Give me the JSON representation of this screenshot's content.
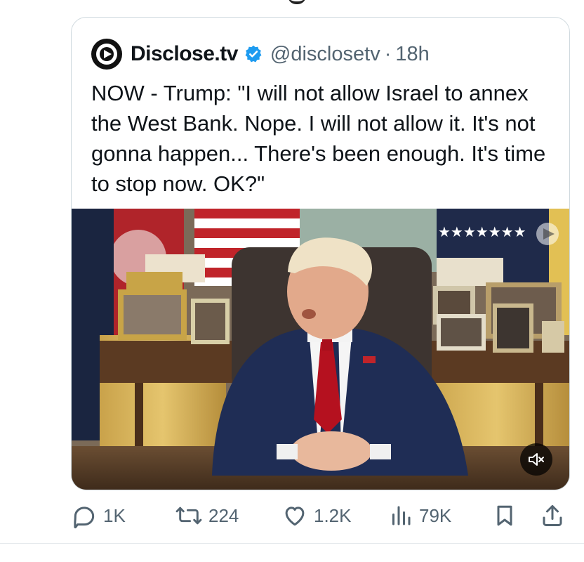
{
  "quote": {
    "display_name": "Disclose.tv",
    "handle": "@disclosetv",
    "separator": "·",
    "time": "18h",
    "text": "NOW - Trump: \"I will not allow Israel to annex the West Bank. Nope. I will not allow it. It's not gonna happen... There's been enough. It's time to stop now. OK?\""
  },
  "media": {
    "watermark_icon": "disclose-logo-icon",
    "mute_icon": "speaker-muted-icon"
  },
  "actions": {
    "replies": "1K",
    "reposts": "224",
    "likes": "1.2K",
    "views": "79K"
  },
  "colors": {
    "verified": "#1d9bf0",
    "muted_text": "#536471",
    "border": "#cfd9de"
  }
}
